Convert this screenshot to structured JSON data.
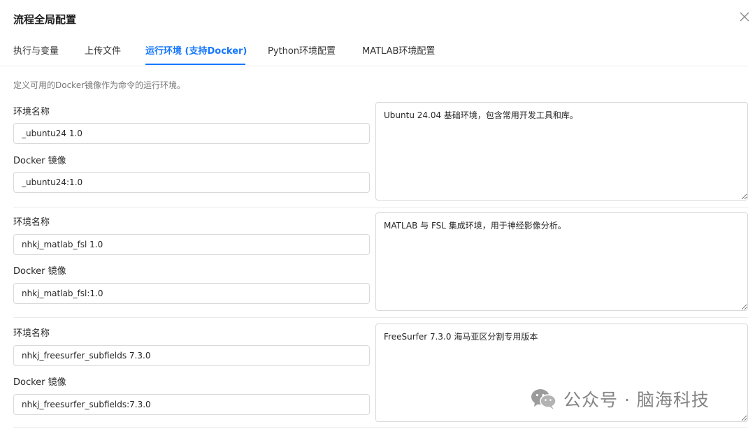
{
  "dialog": {
    "title": "流程全局配置"
  },
  "tabs": [
    {
      "label": "执行与变量"
    },
    {
      "label": "上传文件"
    },
    {
      "label": "运行环境 (支持Docker)"
    },
    {
      "label": "Python环境配置"
    },
    {
      "label": "MATLAB环境配置"
    }
  ],
  "active_tab": "运行环境 (支持Docker)",
  "description": "定义可用的Docker镜像作为命令的运行环境。",
  "labels": {
    "env_name": "环境名称",
    "docker_image": "Docker 镜像"
  },
  "environments": [
    {
      "name": "_ubuntu24 1.0",
      "image": "_ubuntu24:1.0",
      "description": "Ubuntu 24.04 基础环境，包含常用开发工具和库。"
    },
    {
      "name": "nhkj_matlab_fsl 1.0",
      "image": "nhkj_matlab_fsl:1.0",
      "description": "MATLAB 与 FSL 集成环境，用于神经影像分析。"
    },
    {
      "name": "nhkj_freesurfer_subfields 7.3.0",
      "image": "nhkj_freesurfer_subfields:7.3.0",
      "description": "FreeSurfer 7.3.0 海马亚区分割专用版本"
    }
  ],
  "watermark": {
    "text": "公众号 · 脑海科技",
    "icon": "wechat-icon"
  },
  "colors": {
    "accent": "#1677ff",
    "border": "#d9d9d9",
    "muted_text": "#777777"
  }
}
